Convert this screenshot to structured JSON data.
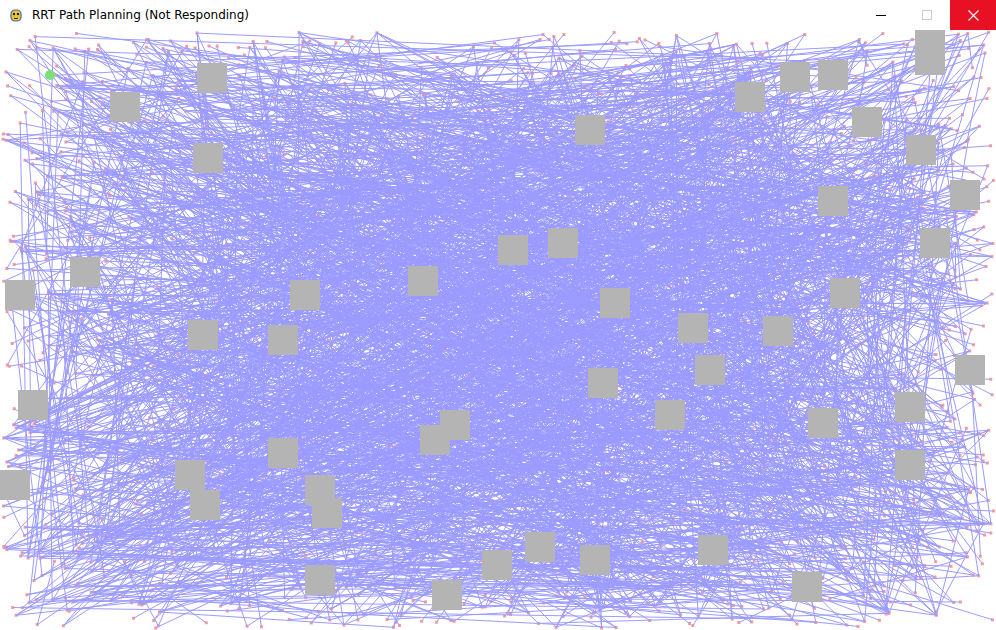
{
  "window": {
    "title": "RRT Path Planning  (Not Responding)",
    "controls": [
      {
        "kind": "minimize",
        "disabled": false
      },
      {
        "kind": "maximize",
        "disabled": true
      },
      {
        "kind": "close",
        "disabled": false
      }
    ]
  }
}
